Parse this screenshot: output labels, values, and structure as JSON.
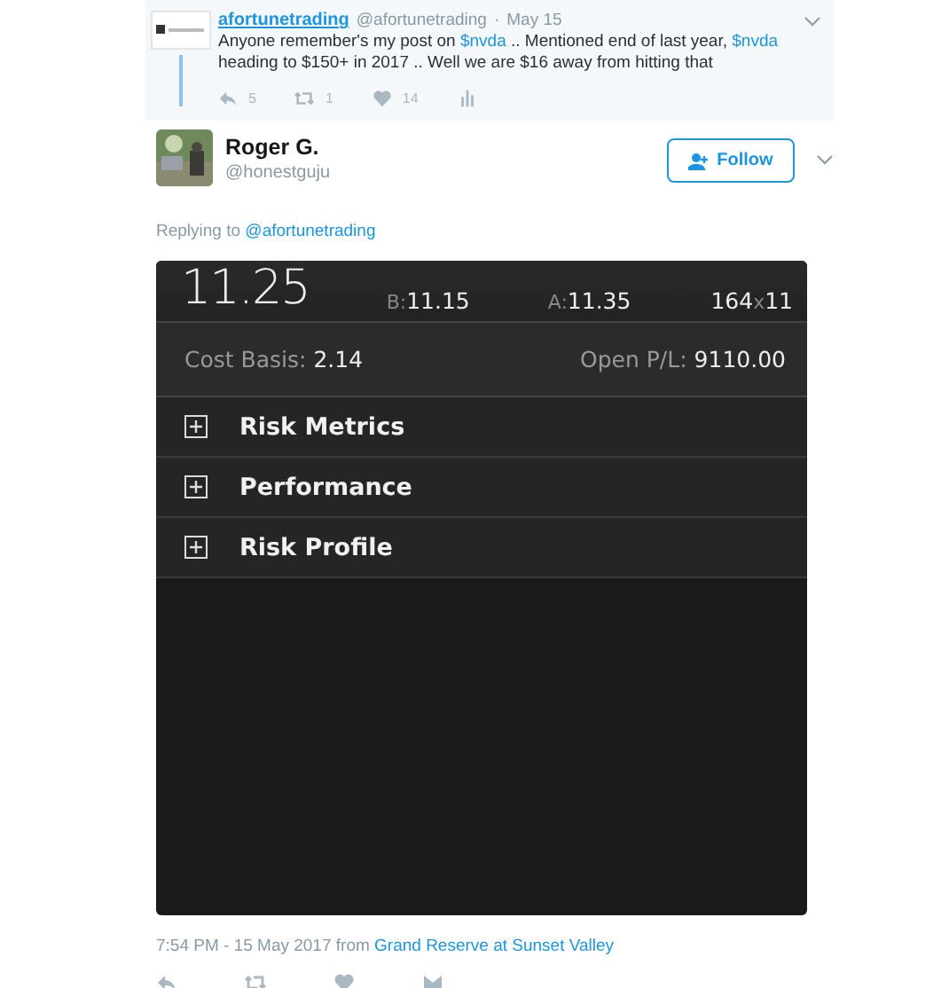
{
  "parent_tweet": {
    "name": "afortunetrading",
    "handle": "@afortunetrading",
    "separator": "·",
    "date": "May 15",
    "text_parts": [
      {
        "text": "Anyone remember's my post on ",
        "link": false
      },
      {
        "text": "$nvda",
        "link": true
      },
      {
        "text": " .. Mentioned end of last year, ",
        "link": false
      },
      {
        "text": "$nvda",
        "link": true
      },
      {
        "text": " heading to $150+ in 2017 .. Well we are $16 away from hitting that",
        "link": false
      }
    ],
    "actions": [
      {
        "kind": "reply",
        "count": "5"
      },
      {
        "kind": "retweet",
        "count": "1"
      },
      {
        "kind": "like",
        "count": "14"
      },
      {
        "kind": "stats"
      }
    ]
  },
  "tweet": {
    "name": "Roger G.",
    "handle": "@honestguju",
    "follow_label": "Follow",
    "replying_prefix": "Replying to",
    "replying_to": "@afortunetrading",
    "trade_panel": {
      "last": "11.25",
      "bid_label": "B:",
      "bid": "11.15",
      "ask_label": "A:",
      "ask": "11.35",
      "size": "164",
      "size_sep": "x",
      "size2": "11",
      "cost_label": "Cost Basis:",
      "cost": "2.14",
      "pl_label": "Open P/L:",
      "pl": "9110.00",
      "sections": [
        {
          "label": "Risk Metrics",
          "expanded": false
        },
        {
          "label": "Performance",
          "expanded": false
        },
        {
          "label": "Risk Profile",
          "expanded": false
        }
      ]
    },
    "timestamp": "7:54 PM - 15 May 2017",
    "from_prefix": "from",
    "location": "Grand Reserve at Sunset Valley",
    "actions": [
      {
        "kind": "reply"
      },
      {
        "kind": "retweet"
      },
      {
        "kind": "like"
      },
      {
        "kind": "message"
      }
    ]
  }
}
